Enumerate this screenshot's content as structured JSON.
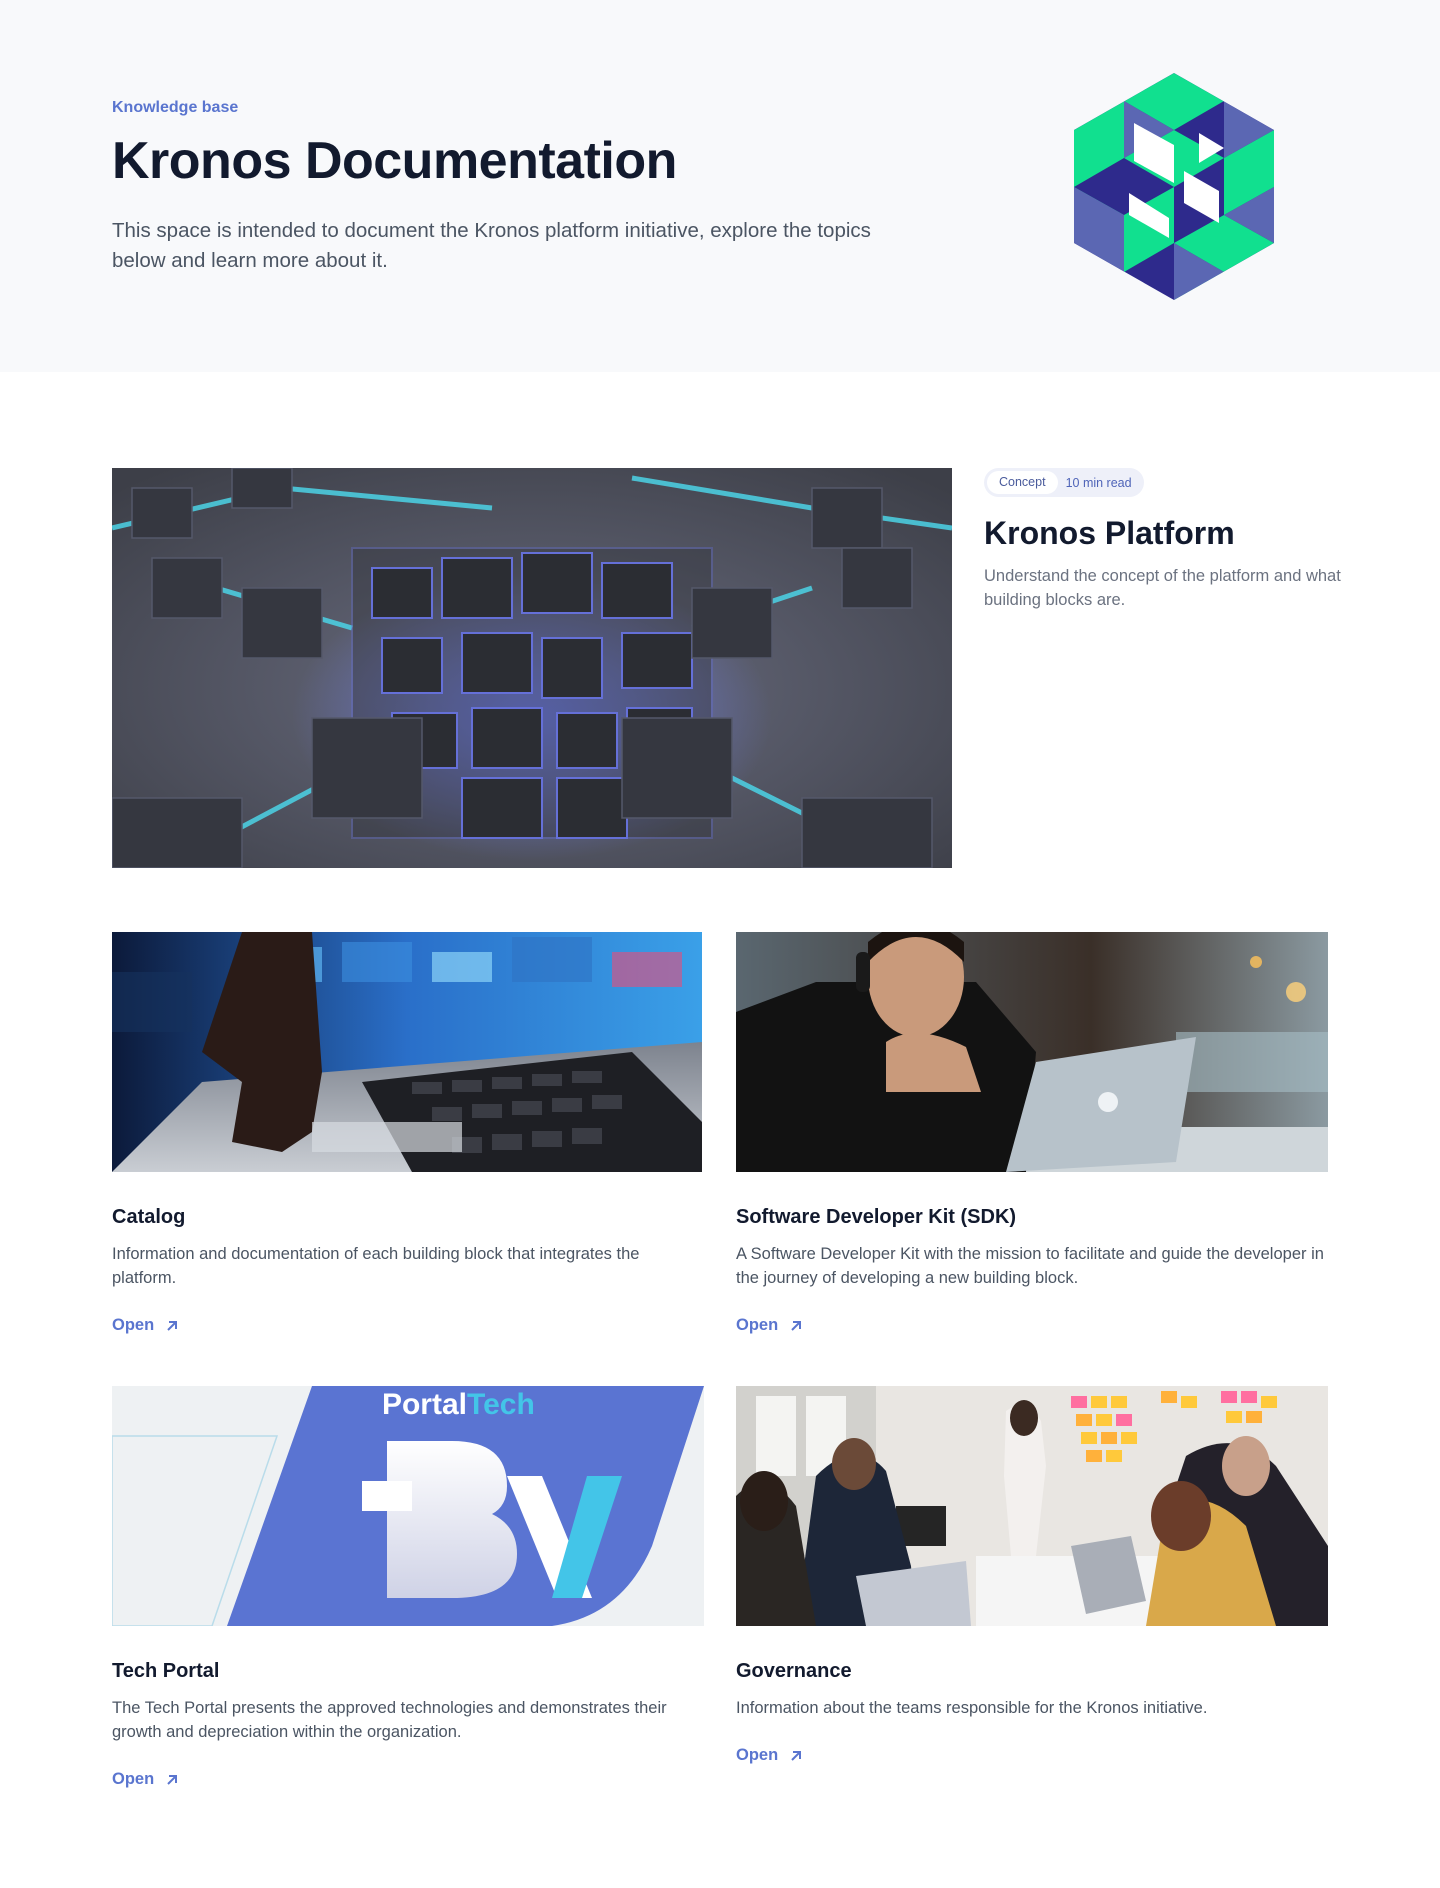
{
  "hero": {
    "eyebrow": "Knowledge base",
    "title": "Kronos Documentation",
    "description": "This space is intended to document the Kronos platform initiative, explore the topics below and learn more about it."
  },
  "featured": {
    "tag": "Concept",
    "read_time": "10 min read",
    "title": "Kronos Platform",
    "description": "Understand the concept of the platform and what building blocks are."
  },
  "cards": [
    {
      "title": "Catalog",
      "description": "Information and documentation of each building block that integrates the platform.",
      "link": "Open"
    },
    {
      "title": "Software Developer Kit (SDK)",
      "description": "A Software Developer Kit with the mission to facilitate and guide the developer in the journey of developing a new building block.",
      "link": "Open"
    },
    {
      "title": "Tech Portal",
      "description": "The Tech Portal presents the approved technologies and demonstrates their growth and depreciation within the organization.",
      "link": "Open",
      "image_text": {
        "portal": "Portal",
        "tech": "Tech"
      }
    },
    {
      "title": "Governance",
      "description": "Information about the teams responsible for the Kronos initiative.",
      "link": "Open"
    }
  ],
  "colors": {
    "accent": "#5a75cf",
    "heading": "#121a2e",
    "hero_bg": "#f8f9fb",
    "logo_green": "#11e08f",
    "logo_navy": "#2e2a8c",
    "logo_blue": "#5b67b3"
  }
}
